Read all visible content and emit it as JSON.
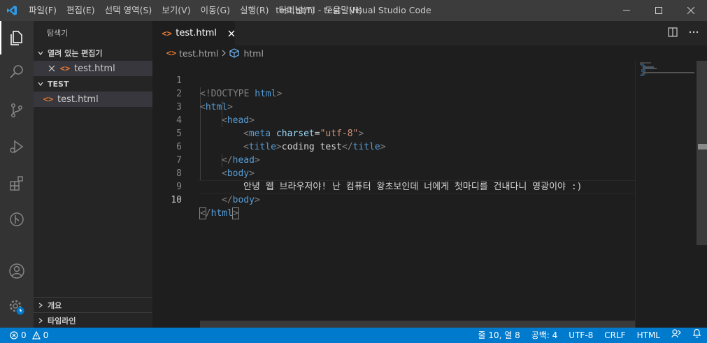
{
  "titlebar": {
    "menu": [
      "파일(F)",
      "편집(E)",
      "선택 영역(S)",
      "보기(V)",
      "이동(G)",
      "실행(R)",
      "터미널(T)",
      "도움말(H)"
    ],
    "title": "test.html - test - Visual Studio Code"
  },
  "activitybar": {
    "icons": [
      "explorer-icon",
      "search-icon",
      "source-control-icon",
      "run-debug-icon",
      "extensions-icon",
      "timeline-git-icon",
      "account-icon",
      "manage-gear-icon"
    ]
  },
  "sidebar": {
    "title": "탐색기",
    "open_editors": {
      "header": "열려 있는 편집기",
      "items": [
        {
          "name": "test.html"
        }
      ]
    },
    "folder": {
      "header": "TEST",
      "items": [
        {
          "name": "test.html"
        }
      ]
    },
    "outline": "개요",
    "timeline": "타임라인"
  },
  "editor": {
    "tab": {
      "label": "test.html"
    },
    "breadcrumb": {
      "file": "test.html",
      "symbol": "html"
    },
    "line_numbers": [
      "1",
      "2",
      "3",
      "4",
      "5",
      "6",
      "7",
      "8",
      "9",
      "10"
    ],
    "code": {
      "doctype_open": "<!DOCTYPE ",
      "doctype_html": "html",
      "doctype_close": ">",
      "html": "html",
      "head": "head",
      "meta": "meta",
      "charset": "charset",
      "eq": "=",
      "charset_value": "\"utf-8\"",
      "title": "title",
      "title_text": "coding test",
      "body": "body",
      "body_text": "안녕 웹 브라우저야! 난 컴퓨터 왕초보인데 너에게 첫마디를 건내다니 영광이야 :)"
    }
  },
  "statusbar": {
    "errors": "0",
    "warnings": "0",
    "position": "줄 10, 열 8",
    "spaces": "공백: 4",
    "encoding": "UTF-8",
    "eol": "CRLF",
    "language": "HTML"
  },
  "colors": {
    "titlebar": "#3c3c3c",
    "activitybar": "#333333",
    "sidebar": "#252526",
    "editor": "#1e1e1e",
    "statusbar": "#007acc",
    "tag": "#569cd6",
    "attr": "#9cdcfe",
    "string": "#ce9178",
    "html_icon": "#e37933"
  }
}
